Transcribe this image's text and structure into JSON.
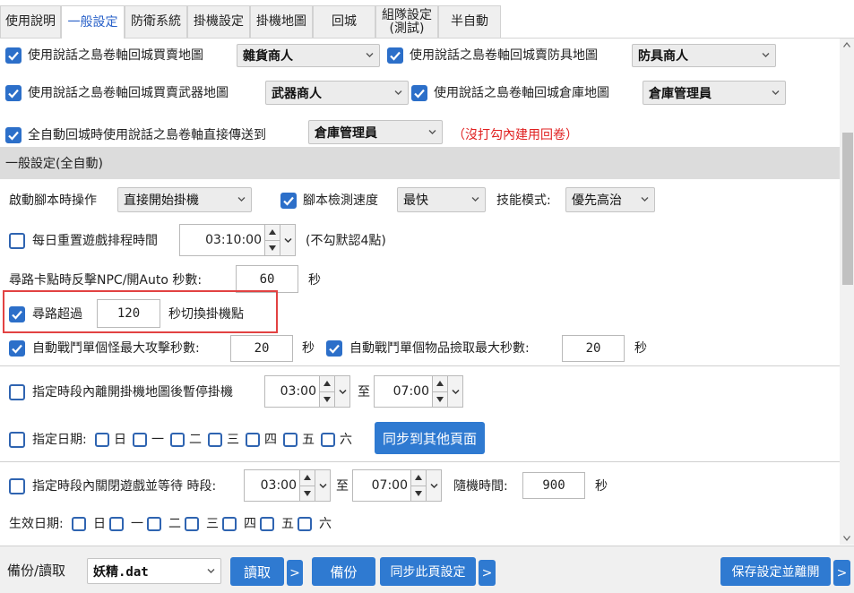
{
  "tabs": [
    {
      "label": "使用說明"
    },
    {
      "label": "一般設定",
      "active": true
    },
    {
      "label": "防衛系統"
    },
    {
      "label": "掛機設定"
    },
    {
      "label": "掛機地圖"
    },
    {
      "label": "回城"
    },
    {
      "label": "組隊設定\n(測試)"
    },
    {
      "label": "半自動"
    }
  ],
  "town": {
    "sell_map": {
      "checked": true,
      "label": "使用說話之島卷軸回城買賣地圖",
      "value": "雜貨商人"
    },
    "armor_map": {
      "checked": true,
      "label": "使用說話之島卷軸回城賣防具地圖",
      "value": "防具商人"
    },
    "weapon_map": {
      "checked": true,
      "label": "使用說話之島卷軸回城買賣武器地圖",
      "value": "武器商人"
    },
    "warehouse_map": {
      "checked": true,
      "label": "使用說話之島卷軸回城倉庫地圖",
      "value": "倉庫管理員"
    },
    "auto_return": {
      "checked": true,
      "label": "全自動回城時使用說話之島卷軸直接傳送到",
      "value": "倉庫管理員",
      "note": "（沒打勾內建用回卷）"
    }
  },
  "section_general": "一般設定(全自動)",
  "general": {
    "startup_label": "啟動腳本時操作",
    "startup_value": "直接開始掛機",
    "speed_checked": true,
    "speed_label": "腳本檢測速度",
    "speed_value": "最快",
    "skill_label": "技能模式:",
    "skill_value": "優先高治",
    "daily_reset_checked": false,
    "daily_reset_label": "每日重置遊戲排程時間",
    "daily_reset_time": "03:10:00",
    "daily_reset_note": "(不勾默認4點)",
    "stuck_label": "尋路卡點時反擊NPC/開Auto 秒數:",
    "stuck_value": "60",
    "stuck_unit": "秒",
    "path_checked": true,
    "path_label": "尋路超過",
    "path_value": "120",
    "path_unit": "秒切換掛機點",
    "monster_checked": true,
    "monster_label": "自動戰鬥單個怪最大攻擊秒數:",
    "monster_value": "20",
    "monster_unit": "秒",
    "item_checked": true,
    "item_label": "自動戰鬥單個物品撿取最大秒數:",
    "item_value": "20",
    "item_unit": "秒"
  },
  "schedule1": {
    "checked": false,
    "label": "指定時段內離開掛機地圖後暫停掛機",
    "from": "03:00",
    "to_label": "至",
    "to": "07:00",
    "date_checked": false,
    "date_label": "指定日期:",
    "days": [
      "日",
      "一",
      "二",
      "三",
      "四",
      "五",
      "六"
    ],
    "sync_label": "同步到其他頁面"
  },
  "schedule2": {
    "checked": false,
    "label": "指定時段內關閉遊戲並等待 時段:",
    "from": "03:00",
    "to_label": "至",
    "to": "07:00",
    "random_label": "隨機時間:",
    "random_value": "900",
    "random_unit": "秒",
    "effective_label": "生效日期:",
    "days": [
      "日",
      "一",
      "二",
      "三",
      "四",
      "五",
      "六"
    ]
  },
  "bottom": {
    "backup_label": "備份/讀取",
    "file_value": "妖精.dat",
    "read_label": "讀取",
    "more1": ">",
    "backup_btn": "備份",
    "sync_page_label": "同步此頁設定",
    "more2": ">",
    "save_exit_label": "保存設定並離開",
    "more3": ">"
  },
  "colors": {
    "accent": "#2f7ad1",
    "check": "#2c6fc9",
    "note": "#e02020",
    "highlight": "#e24242"
  }
}
